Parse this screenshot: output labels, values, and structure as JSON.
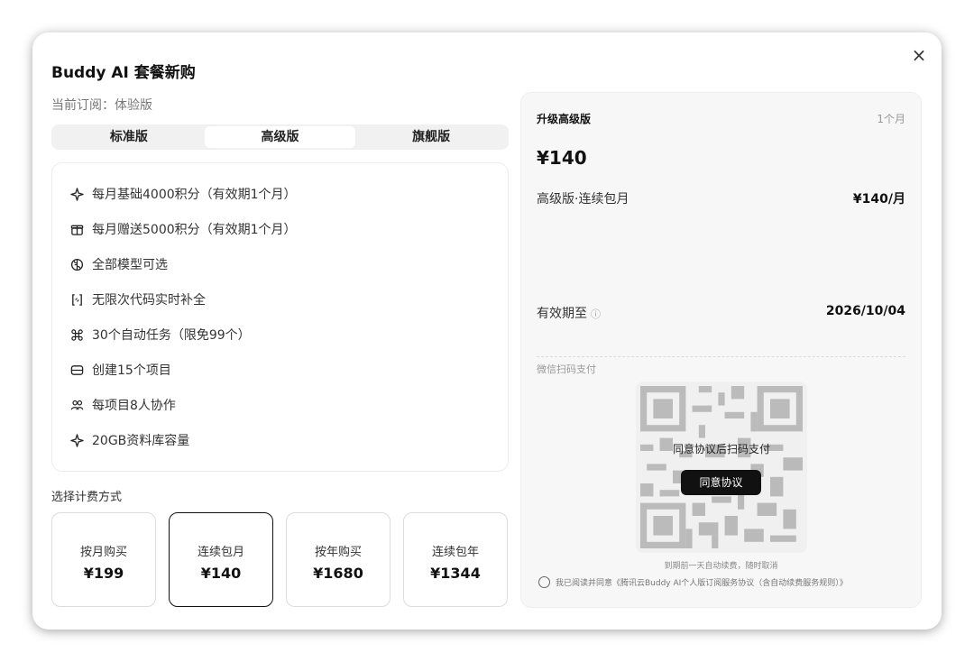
{
  "dialog": {
    "title": "Buddy AI 套餐新购",
    "close_glyph": "×",
    "current_subscription": "当前订阅：体验版"
  },
  "tabs": [
    {
      "label": "标准版",
      "active": false
    },
    {
      "label": "高级版",
      "active": true
    },
    {
      "label": "旗舰版",
      "active": false
    }
  ],
  "features": [
    {
      "icon": "sparkle-icon",
      "text": "每月基础4000积分（有效期1个月）"
    },
    {
      "icon": "gift-icon",
      "text": "每月赠送5000积分（有效期1个月）"
    },
    {
      "icon": "brain-icon",
      "text": "全部模型可选"
    },
    {
      "icon": "code-bracket-icon",
      "text": "无限次代码实时补全"
    },
    {
      "icon": "command-icon",
      "text": "30个自动任务（限免99个）"
    },
    {
      "icon": "folder-icon",
      "text": "创建15个项目"
    },
    {
      "icon": "users-icon",
      "text": "每项目8人协作"
    },
    {
      "icon": "sparkle-icon",
      "text": "20GB资料库容量"
    }
  ],
  "billing": {
    "title": "选择计费方式",
    "options": [
      {
        "name": "按月购买",
        "price": "¥199",
        "selected": false
      },
      {
        "name": "连续包月",
        "price": "¥140",
        "selected": true
      },
      {
        "name": "按年购买",
        "price": "¥1680",
        "selected": false
      },
      {
        "name": "连续包年",
        "price": "¥1344",
        "selected": false
      }
    ]
  },
  "summary": {
    "heading": "升级高级版",
    "duration": "1个月",
    "total": "¥140",
    "line_label": "高级版·连续包月",
    "line_price": "¥140/月",
    "valid_label": "有效期至",
    "valid_info_glyph": "ⓘ",
    "valid_date": "2026/10/04",
    "pay_label": "微信扫码支付",
    "qr_text": "同意协议后扫码支付",
    "agree_button": "同意协议",
    "auto_renew_note": "到期前一天自动续费，随时取消",
    "consent_text": "我已阅读并同意《腾讯云Buddy AI个人版订阅服务协议（含自动续费服务规则）》"
  }
}
